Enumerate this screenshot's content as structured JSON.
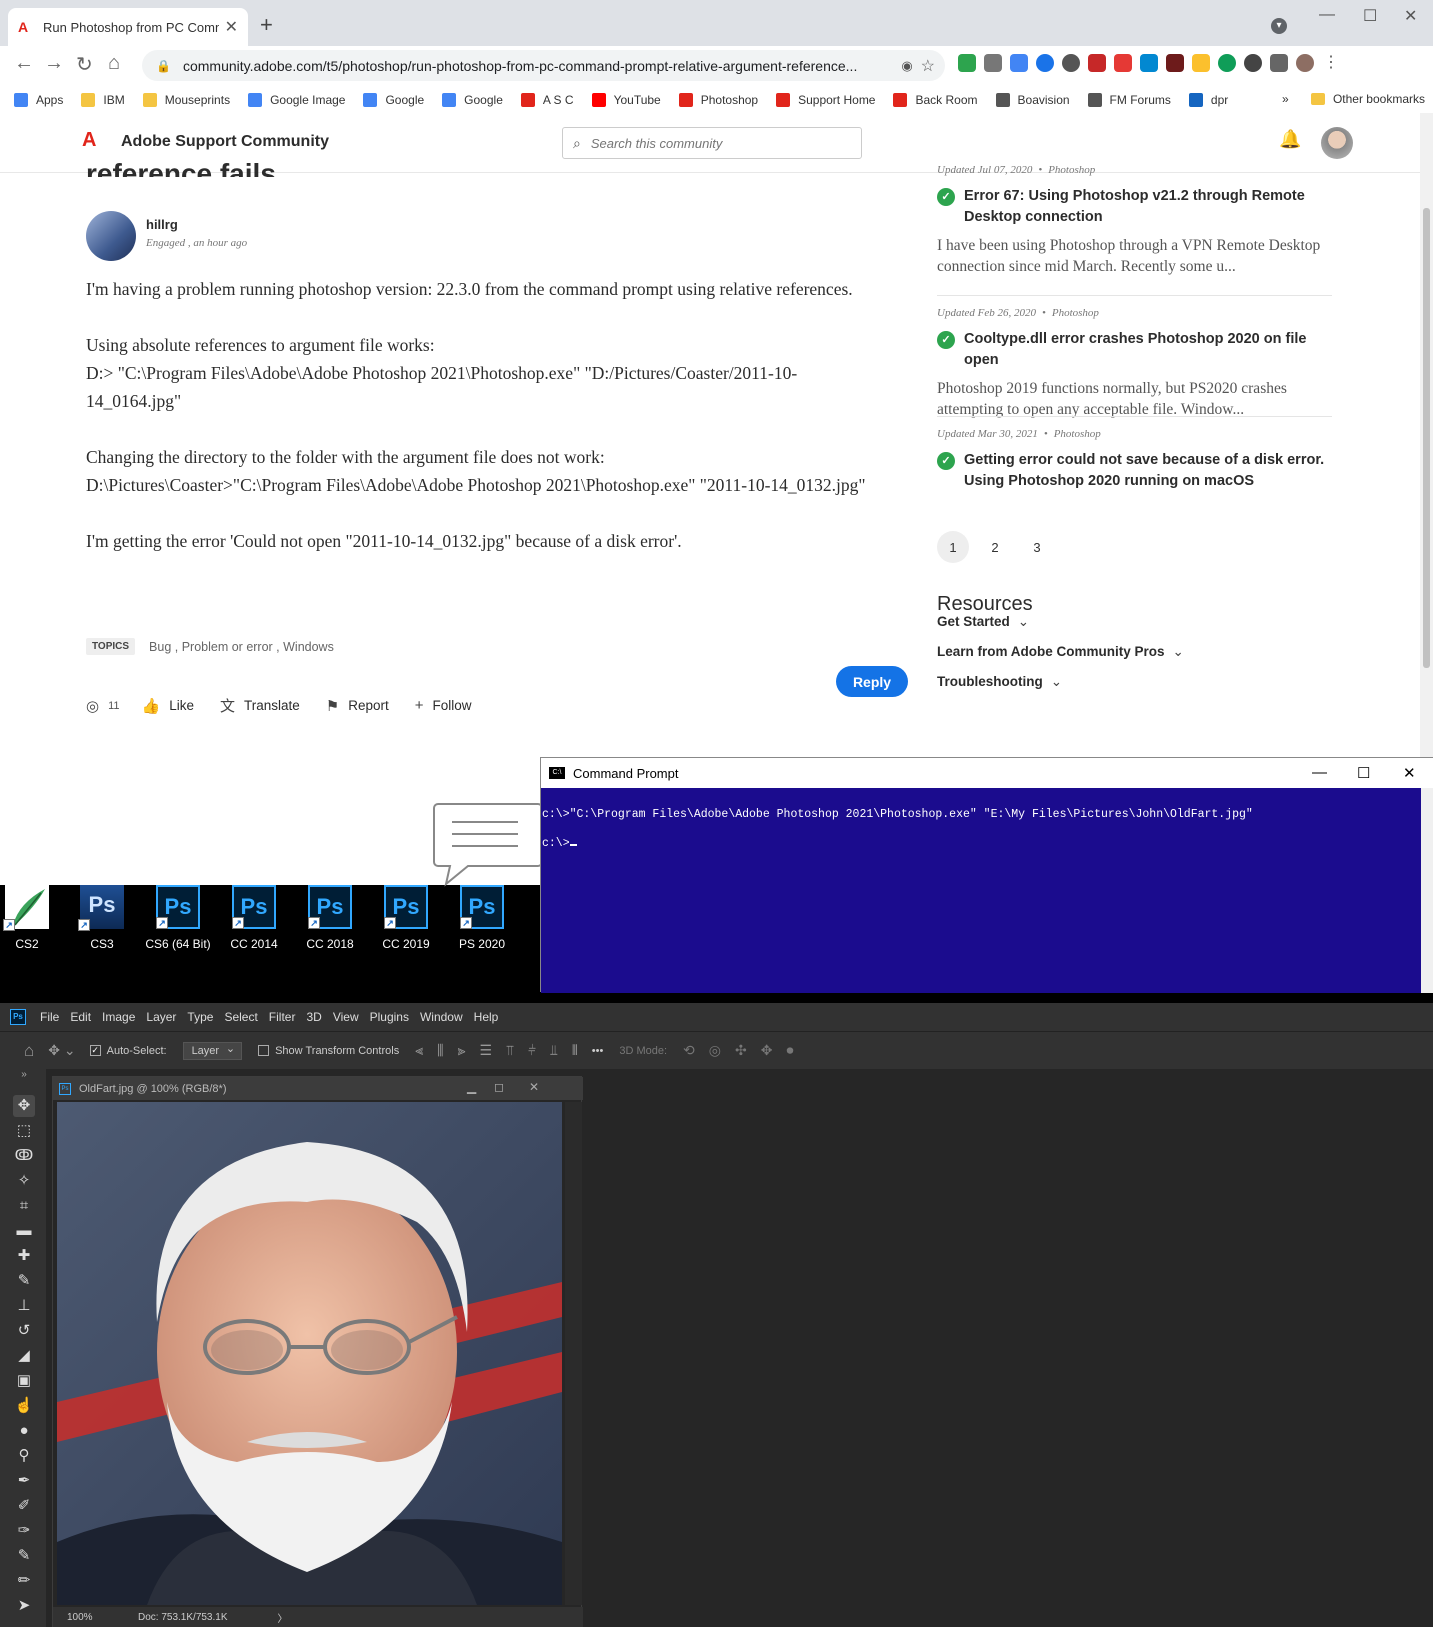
{
  "browser": {
    "tab_title": "Run Photoshop from PC Comma",
    "url": "community.adobe.com/t5/photoshop/run-photoshop-from-pc-command-prompt-relative-argument-reference...",
    "bookmarks": [
      {
        "label": "Apps",
        "color": "#4285f4"
      },
      {
        "label": "IBM",
        "color": "#f4c542"
      },
      {
        "label": "Mouseprints",
        "color": "#f4c542"
      },
      {
        "label": "Google Image",
        "color": "#4285f4"
      },
      {
        "label": "Google",
        "color": "#4285f4"
      },
      {
        "label": "Google",
        "color": "#4285f4"
      },
      {
        "label": "A S C",
        "color": "#e1251b"
      },
      {
        "label": "YouTube",
        "color": "#ff0000"
      },
      {
        "label": "Photoshop",
        "color": "#e1251b"
      },
      {
        "label": "Support Home",
        "color": "#e1251b"
      },
      {
        "label": "Back Room",
        "color": "#e1251b"
      },
      {
        "label": "Boavision",
        "color": "#555555"
      },
      {
        "label": "FM Forums",
        "color": "#555555"
      },
      {
        "label": "dpr",
        "color": "#1565c0"
      }
    ],
    "bookmarks_more": "»",
    "other_bookmarks": "Other bookmarks"
  },
  "site": {
    "title": "Adobe Support Community",
    "search_placeholder": "Search this community"
  },
  "post": {
    "title_fragment": "reference fails",
    "author": "hillrg",
    "author_meta": "Engaged , an hour ago",
    "paragraphs": [
      "I'm having a problem running photoshop version: 22.3.0 from the command prompt using relative references.",
      "Using absolute references to argument file works:\nD:> \"C:\\Program Files\\Adobe\\Adobe Photoshop 2021\\Photoshop.exe\" \"D:/Pictures/Coaster/2011-10-14_0164.jpg\"",
      "Changing the directory to the folder with the argument file does not work:\nD:\\Pictures\\Coaster>\"C:\\Program Files\\Adobe\\Adobe Photoshop 2021\\Photoshop.exe\" \"2011-10-14_0132.jpg\"",
      "I'm getting the error 'Could not open \"2011-10-14_0132.jpg\" because of a disk error'."
    ],
    "topics_label": "TOPICS",
    "topics": "Bug ,  Problem or error ,  Windows",
    "views": "11",
    "like": "Like",
    "translate": "Translate",
    "report": "Report",
    "follow": "Follow",
    "reply": "Reply"
  },
  "related": [
    {
      "meta_date": "Updated Jul 07, 2020",
      "meta_cat": "Photoshop",
      "title": "Error 67: Using Photoshop v21.2 through Remote Desktop connection",
      "snippet": "I have been using Photoshop through a VPN Remote Desktop connection since mid March. Recently some u..."
    },
    {
      "meta_date": "Updated Feb 26, 2020",
      "meta_cat": "Photoshop",
      "title": "Cooltype.dll error crashes Photoshop 2020 on file open",
      "snippet": "Photoshop 2019 functions normally, but PS2020 crashes attempting to open any acceptable file. Window..."
    },
    {
      "meta_date": "Updated Mar 30, 2021",
      "meta_cat": "Photoshop",
      "title": "Getting error could not save because of a disk error. Using Photoshop 2020 running on macOS",
      "snippet": ""
    }
  ],
  "pager": [
    "1",
    "2",
    "3"
  ],
  "resources": {
    "title": "Resources",
    "items": [
      "Get Started",
      "Learn from Adobe Community Pros",
      "Troubleshooting"
    ]
  },
  "desktop_icons": [
    "CS2",
    "CS3",
    "CS6 (64 Bit)",
    "CC 2014",
    "CC 2018",
    "CC 2019",
    "PS 2020"
  ],
  "cmd": {
    "title": "Command Prompt",
    "line1": "c:\\>\"C:\\Program Files\\Adobe\\Adobe Photoshop 2021\\Photoshop.exe\" \"E:\\My Files\\Pictures\\John\\OldFart.jpg\"",
    "line2": "c:\\>"
  },
  "photoshop": {
    "menu": [
      "File",
      "Edit",
      "Image",
      "Layer",
      "Type",
      "Select",
      "Filter",
      "3D",
      "View",
      "Plugins",
      "Window",
      "Help"
    ],
    "auto_select": "Auto-Select:",
    "layer_option": "Layer",
    "show_transform": "Show Transform Controls",
    "more": "•••",
    "mode_3d": "3D Mode:",
    "doc_title": "OldFart.jpg @ 100% (RGB/8*)",
    "zoom": "100%",
    "doc_size": "Doc: 753.1K/753.1K",
    "status_arrow": "〉"
  }
}
